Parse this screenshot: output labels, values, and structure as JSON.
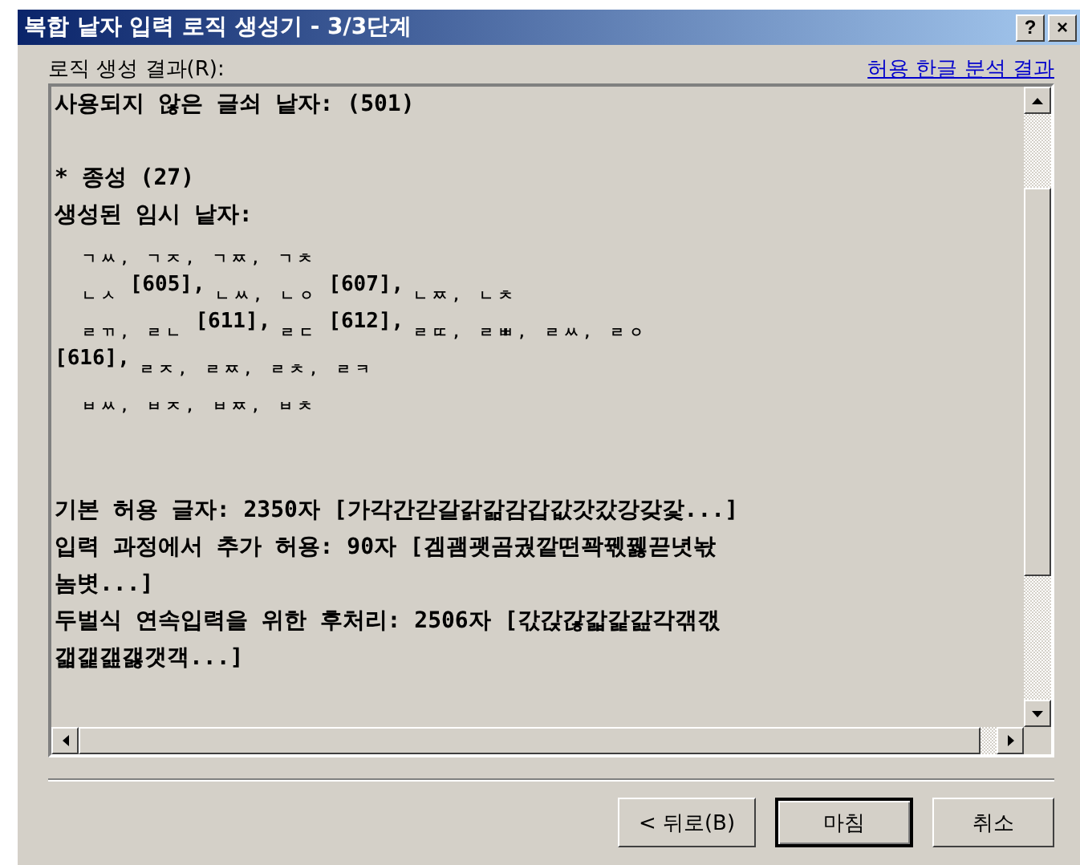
{
  "window": {
    "title": "복합 낱자 입력 로직 생성기 - 3/3단계",
    "title_buttons": [
      "?",
      "×"
    ]
  },
  "result_label": "로직 생성 결과(R):",
  "result_link": "허용 한글 분석 결과",
  "lines": [
    {
      "kind": "text",
      "text": "사용되지 않은 글쇠 낱자: (501)"
    },
    {
      "kind": "blank"
    },
    {
      "kind": "text",
      "text": "* 종성 (27)"
    },
    {
      "kind": "text",
      "text": "생성된 임시 낱자:"
    },
    {
      "kind": "jamo",
      "parts": [
        {
          "kind": "jamo",
          "text": "  ㄱㅆ, ㄱㅈ, ㄱㅉ, ㄱㅊ"
        }
      ]
    },
    {
      "kind": "jamo",
      "parts": [
        {
          "kind": "jamo",
          "text": "  ㄴㅅ"
        },
        {
          "kind": "code",
          "text": "[605],"
        },
        {
          "kind": "jamo",
          "text": "ㄴㅆ, ㄴㅇ"
        },
        {
          "kind": "code",
          "text": "[607],"
        },
        {
          "kind": "jamo",
          "text": "ㄴㅉ, ㄴㅊ"
        }
      ]
    },
    {
      "kind": "jamo",
      "parts": [
        {
          "kind": "jamo",
          "text": "  ㄹㄲ, ㄹㄴ"
        },
        {
          "kind": "code",
          "text": "[611],"
        },
        {
          "kind": "jamo",
          "text": "ㄹㄷ"
        },
        {
          "kind": "code",
          "text": "[612],"
        },
        {
          "kind": "jamo",
          "text": "ㄹㄸ, ㄹㅃ, ㄹㅆ, ㄹㅇ"
        }
      ]
    },
    {
      "kind": "jamo",
      "parts": [
        {
          "kind": "code",
          "text": "[616],"
        },
        {
          "kind": "jamo",
          "text": "ㄹㅈ, ㄹㅉ, ㄹㅊ, ㄹㅋ"
        }
      ]
    },
    {
      "kind": "jamo",
      "parts": [
        {
          "kind": "jamo",
          "text": "  ㅂㅆ, ㅂㅈ, ㅂㅉ, ㅂㅊ"
        }
      ]
    },
    {
      "kind": "blank"
    },
    {
      "kind": "blank"
    },
    {
      "kind": "text",
      "text": "기본 허용 글자: 2350자 [가각간갇갈갉갊감갑값갓갔강갖갗...]"
    },
    {
      "kind": "text",
      "text": "입력 과정에서 추가 허용: 90자 [겜괨괫곰궜깥떤꽉꿳꿿끋녓놗"
    },
    {
      "kind": "text",
      "text": "놈볏...]"
    },
    {
      "kind": "text",
      "text": "두벌식 연속입력을 위한 후처리: 2506자 [갃갅갆갋갍갎각갞갟"
    },
    {
      "kind": "text",
      "text": "갧갩갪갫갯객...]"
    }
  ],
  "buttons": [
    {
      "label": "< 뒤로(B)",
      "default": false
    },
    {
      "label": "마침",
      "default": true
    },
    {
      "label": "취소",
      "default": false
    }
  ]
}
